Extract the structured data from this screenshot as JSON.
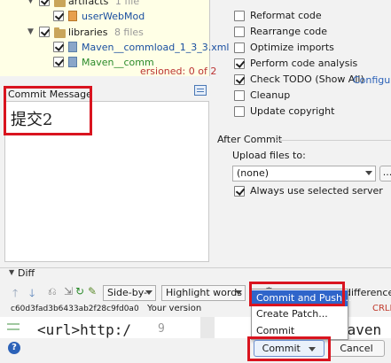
{
  "colors": {
    "highlight_red": "#d9141f",
    "menu_selected": "#2f65ca",
    "tree_bg": "#ffffe6",
    "link_blue": "#2c62b8",
    "warning_red": "#c0392b"
  },
  "tree": {
    "row1": {
      "label": "artifacts",
      "meta": "1 file"
    },
    "row2": {
      "label": "userWebMod"
    },
    "row3": {
      "label": "libraries",
      "meta": "8 files"
    },
    "row4": {
      "label": "Maven__commload_1_3_3.xml"
    },
    "row5": {
      "label": "Maven__comm"
    },
    "status": "ersioned: 0 of 2"
  },
  "commit_message": {
    "label": "Commit Message",
    "value": "提交2"
  },
  "before_commit": {
    "options": [
      {
        "label": "Reformat code",
        "checked": false
      },
      {
        "label": "Rearrange code",
        "checked": false
      },
      {
        "label": "Optimize imports",
        "checked": false
      },
      {
        "label": "Perform code analysis",
        "checked": true
      },
      {
        "label": "Check TODO (Show All)",
        "checked": true
      },
      {
        "label": "Cleanup",
        "checked": false
      },
      {
        "label": "Update copyright",
        "checked": false
      }
    ],
    "configure_link": "Configur"
  },
  "after_commit": {
    "title": "After Commit",
    "upload_label": "Upload files to:",
    "upload_value": "(none)",
    "browse_label": "...",
    "always_use_label": "Always use selected server",
    "always_use_checked": true
  },
  "diff": {
    "title": "Diff",
    "viewer_mode": "Side-by-",
    "highlight_mode": "Highlight words",
    "differences_label": "differences",
    "hash": "c60d3fad3b6433ab2f28c9fd0a0",
    "your_version": "Your version",
    "crlf": "CRLF",
    "left_code": "<url>http:/",
    "line_number": "9",
    "right_code": "Maven"
  },
  "commit_menu": {
    "items": [
      "Commit and Push...",
      "Create Patch...",
      "Commit"
    ]
  },
  "footer": {
    "help_icon": "?",
    "commit_label": "Commit",
    "cancel_label": "Cancel"
  }
}
